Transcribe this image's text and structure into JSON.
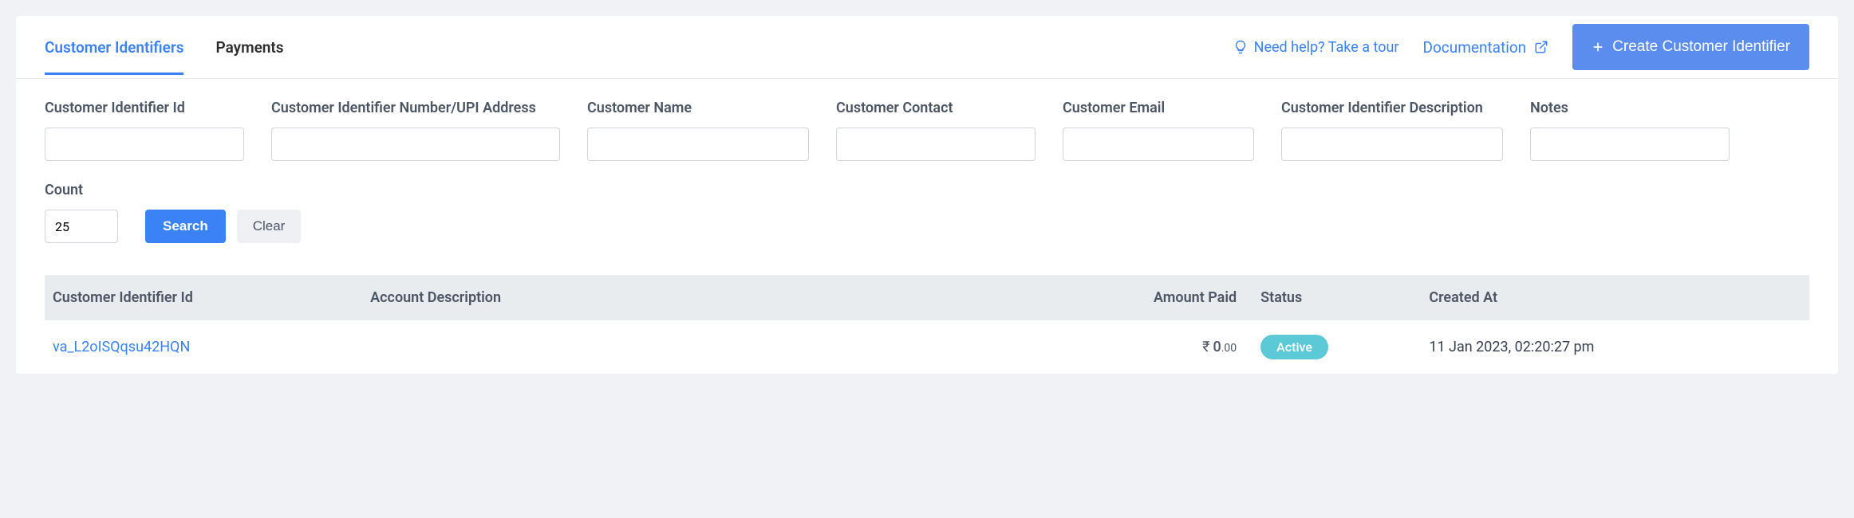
{
  "tabs": {
    "customerIdentifiers": "Customer Identifiers",
    "payments": "Payments"
  },
  "header": {
    "help_label": "Need help? Take a tour",
    "doc_label": "Documentation",
    "create_label": "Create Customer Identifier"
  },
  "filters": {
    "id_label": "Customer Identifier Id",
    "number_label": "Customer Identifier Number/UPI Address",
    "name_label": "Customer Name",
    "contact_label": "Customer Contact",
    "email_label": "Customer Email",
    "desc_label": "Customer Identifier Description",
    "notes_label": "Notes",
    "count_label": "Count",
    "count_value": "25",
    "search_label": "Search",
    "clear_label": "Clear"
  },
  "table": {
    "headers": {
      "id": "Customer Identifier Id",
      "desc": "Account Description",
      "amount": "Amount Paid",
      "status": "Status",
      "created": "Created At"
    },
    "rows": [
      {
        "id": "va_L2oISQqsu42HQN",
        "desc": "",
        "amount_sym": "₹",
        "amount_int": "0",
        "amount_dec": ".00",
        "status": "Active",
        "created": "11 Jan 2023, 02:20:27 pm"
      }
    ]
  }
}
